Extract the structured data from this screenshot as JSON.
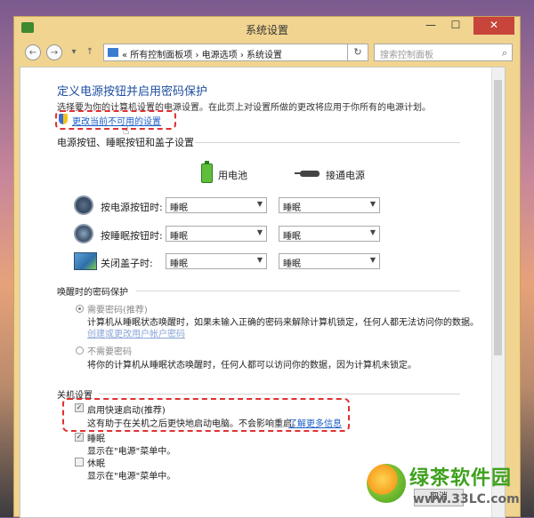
{
  "window": {
    "title": "系统设置",
    "min": "—",
    "max": "☐",
    "close": "✕"
  },
  "nav": {
    "back": "←",
    "forward": "→",
    "history": "▾",
    "up": "↑",
    "breadcrumb": "« 所有控制面板项 › 电源选项 › 系统设置",
    "refresh": "↻",
    "search_placeholder": "搜索控制面板",
    "search_icon": "⌕"
  },
  "main": {
    "heading": "定义电源按钮并启用密码保护",
    "description": "选择要为你的计算机设置的电源设置。在此页上对设置所做的更改将应用于你所有的电源计划。",
    "change_link": "更改当前不可用的设置"
  },
  "power_section": {
    "title": "电源按钮、睡眠按钮和盖子设置",
    "battery_label": "用电池",
    "plugged_label": "接通电源",
    "rows": [
      {
        "label": "按电源按钮时:",
        "battery": "睡眠",
        "plugged": "睡眠",
        "icon": "power-button-icon"
      },
      {
        "label": "按睡眠按钮时:",
        "battery": "睡眠",
        "plugged": "睡眠",
        "icon": "sleep-button-icon"
      },
      {
        "label": "关闭盖子时:",
        "battery": "睡眠",
        "plugged": "睡眠",
        "icon": "laptop-lid-icon"
      }
    ]
  },
  "wake_section": {
    "title": "唤醒时的密码保护",
    "require_label": "需要密码(推荐)",
    "require_desc": "计算机从睡眠状态唤醒时，如果未输入正确的密码来解除计算机锁定，任何人都无法访问你的数据。",
    "require_link": "创建或更改用户帐户密码",
    "no_require_label": "不需要密码",
    "no_require_desc": "将你的计算机从睡眠状态唤醒时，任何人都可以访问你的数据，因为计算机未锁定。"
  },
  "shutdown_section": {
    "title": "关机设置",
    "fast_startup_label": "启用快速启动(推荐)",
    "fast_startup_desc": "这有助于在关机之后更快地启动电脑。不会影响重启。",
    "learn_more": "了解更多信息",
    "sleep_label": "睡眠",
    "sleep_desc": "显示在\"电源\"菜单中。",
    "hibernate_label": "休眠",
    "hibernate_desc": "显示在\"电源\"菜单中。"
  },
  "buttons": {
    "cancel": "取消"
  },
  "watermark": {
    "name": "绿茶软件园",
    "url": "www.33LC.com"
  },
  "colors": {
    "heading": "#1e4e9f",
    "link": "#1b5fc9",
    "highlight": "#e03030",
    "window_frame": "#f0d490"
  }
}
